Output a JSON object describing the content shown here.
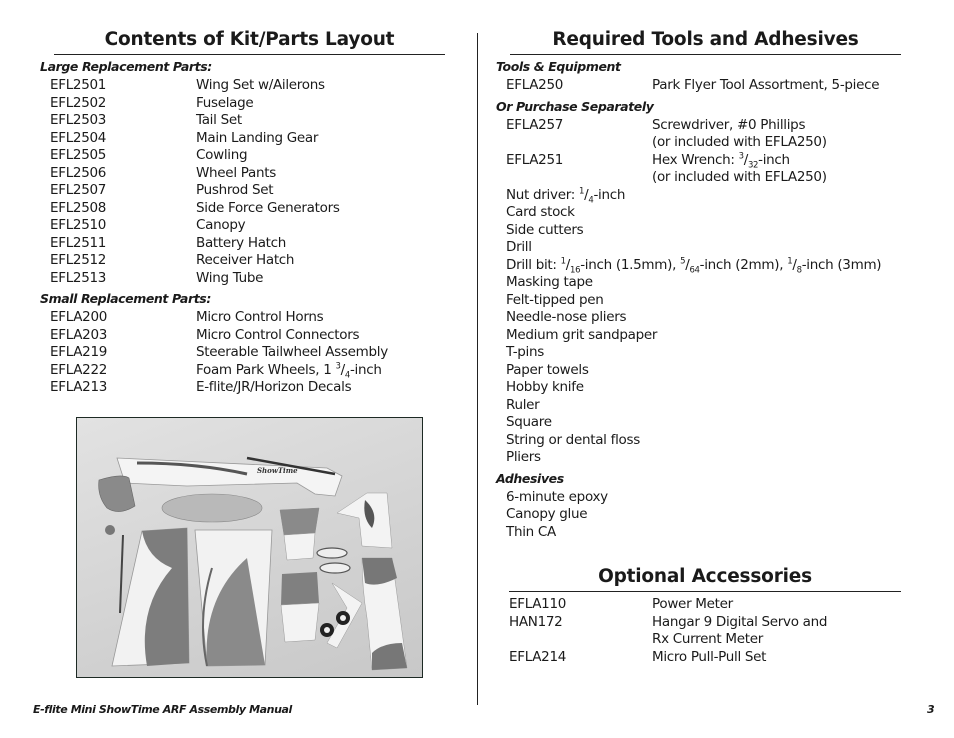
{
  "left": {
    "title": "Contents of Kit/Parts Layout",
    "large_parts": {
      "heading": "Large Replacement Parts:",
      "items": [
        {
          "code": "EFL2501",
          "desc": "Wing Set w/Ailerons"
        },
        {
          "code": "EFL2502",
          "desc": "Fuselage"
        },
        {
          "code": "EFL2503",
          "desc": "Tail Set"
        },
        {
          "code": "EFL2504",
          "desc": "Main Landing Gear"
        },
        {
          "code": "EFL2505",
          "desc": "Cowling"
        },
        {
          "code": "EFL2506",
          "desc": "Wheel Pants"
        },
        {
          "code": "EFL2507",
          "desc": "Pushrod Set"
        },
        {
          "code": "EFL2508",
          "desc": "Side Force Generators"
        },
        {
          "code": "EFL2510",
          "desc": "Canopy"
        },
        {
          "code": "EFL2511",
          "desc": "Battery Hatch"
        },
        {
          "code": "EFL2512",
          "desc": "Receiver Hatch"
        },
        {
          "code": "EFL2513",
          "desc": "Wing Tube"
        }
      ]
    },
    "small_parts": {
      "heading": "Small Replacement Parts:",
      "items": [
        {
          "code": "EFLA200",
          "desc": "Micro Control Horns"
        },
        {
          "code": "EFLA203",
          "desc": "Micro Control Connectors"
        },
        {
          "code": "EFLA219",
          "desc": "Steerable Tailwheel Assembly"
        },
        {
          "code": "EFLA222",
          "desc_prefix": "Foam Park Wheels, 1 ",
          "frac_num": "3",
          "frac_den": "4",
          "desc_suffix": "-inch"
        },
        {
          "code": "EFLA213",
          "desc": "E-flite/JR/Horizon Decals"
        }
      ]
    },
    "photo": {
      "alt": "Kit parts layout photo: fuselage, cowling, canopy, wings, tail surfaces, wheels and wing tube",
      "decal_text": "ShowTime"
    }
  },
  "right": {
    "title": "Required Tools and Adhesives",
    "tools": {
      "heading": "Tools & Equipment",
      "items": [
        {
          "code": "EFLA250",
          "desc": "Park Flyer Tool Assortment, 5-piece"
        }
      ]
    },
    "separately": {
      "heading": "Or Purchase Separately",
      "screwdriver": {
        "code": "EFLA257",
        "desc": "Screwdriver, #0 Phillips",
        "note": "(or included with EFLA250)"
      },
      "hex": {
        "code": "EFLA251",
        "desc_prefix": "Hex Wrench: ",
        "frac_num": "3",
        "frac_den": "32",
        "desc_suffix": "-inch",
        "note": "(or included with EFLA250)"
      },
      "nut_driver": {
        "prefix": "Nut driver: ",
        "frac_num": "1",
        "frac_den": "4",
        "suffix": "-inch"
      },
      "misc1": [
        "Card stock",
        "Side cutters",
        "Drill"
      ],
      "drill_bit": {
        "prefix": "Drill bit: ",
        "a_num": "1",
        "a_den": "16",
        "a_suffix": "-inch (1.5mm), ",
        "b_num": "5",
        "b_den": "64",
        "b_suffix": "-inch (2mm), ",
        "c_num": "1",
        "c_den": "8",
        "c_suffix": "-inch (3mm)"
      },
      "misc2": [
        "Masking tape",
        "Felt-tipped pen",
        "Needle-nose pliers",
        "Medium grit sandpaper",
        "T-pins",
        "Paper towels",
        "Hobby knife",
        "Ruler",
        "Square",
        "String or dental floss",
        "Pliers"
      ]
    },
    "adhesives": {
      "heading": "Adhesives",
      "items": [
        "6-minute epoxy",
        "Canopy glue",
        "Thin CA"
      ]
    },
    "accessories": {
      "title": "Optional Accessories",
      "items": [
        {
          "code": "EFLA110",
          "desc": "Power Meter"
        },
        {
          "code": "HAN172",
          "desc": "Hangar 9 Digital Servo and",
          "desc2": "Rx Current Meter"
        },
        {
          "code": "EFLA214",
          "desc": "Micro Pull-Pull Set"
        }
      ]
    }
  },
  "footer": {
    "title": "E-flite Mini ShowTime ARF Assembly Manual",
    "page": "3"
  }
}
